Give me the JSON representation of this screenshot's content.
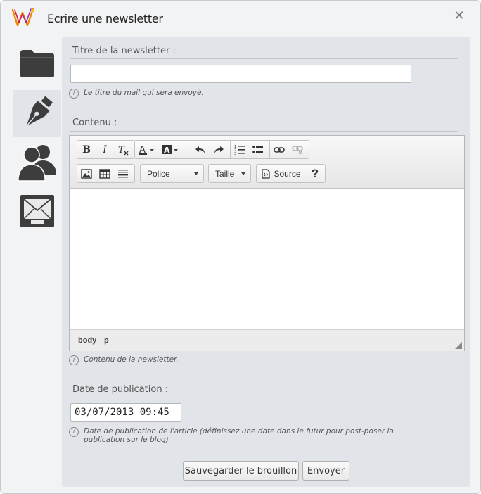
{
  "window": {
    "title": "Ecrire une newsletter",
    "close_glyph": "✕"
  },
  "sidebar": {
    "items": [
      {
        "name": "folder-icon",
        "active": false
      },
      {
        "name": "pen-nib-icon",
        "active": true
      },
      {
        "name": "users-icon",
        "active": false
      },
      {
        "name": "envelope-tray-icon",
        "active": false
      }
    ]
  },
  "form": {
    "title_label": "Titre de la newsletter :",
    "title_value": "",
    "title_hint": "Le titre du mail qui sera envoyé.",
    "content_label": "Contenu :",
    "content_hint": "Contenu de la newsletter.",
    "date_label": "Date de publication :",
    "date_value": "03/07/2013 09:45",
    "date_hint": "Date de publication de l'article (définissez une date dans le futur pour post-poser la publication sur le blog)"
  },
  "editor": {
    "font_combo": "Police",
    "size_combo": "Taille",
    "source_label": "Source",
    "help_label": "?",
    "bold": "B",
    "italic": "I",
    "path": [
      "body",
      "p"
    ]
  },
  "buttons": {
    "save_draft": "Sauvegarder le brouillon",
    "send": "Envoyer"
  },
  "colors": {
    "panel_bg": "#e1e4e8",
    "icon_dark": "#3d3d3d"
  }
}
